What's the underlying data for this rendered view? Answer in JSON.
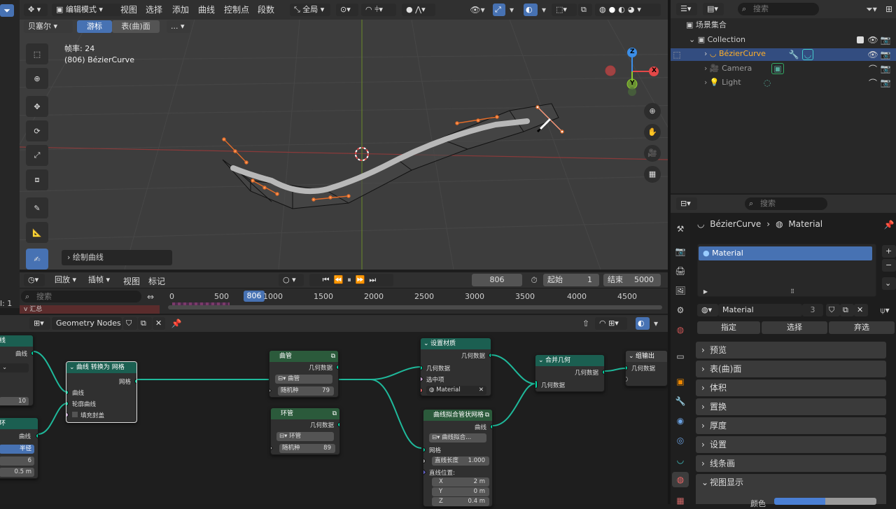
{
  "viewport": {
    "header": {
      "mode": "编辑模式",
      "menus": [
        "视图",
        "选择",
        "添加",
        "曲线",
        "控制点",
        "段数"
      ],
      "transform_orientation": "全局"
    },
    "subheader": {
      "curve_type": "贝塞尔",
      "tab_cursor": "游标",
      "tab_surface": "表(曲)面",
      "more": "..."
    },
    "overlay": {
      "fps": "帧率: 24",
      "object": "(806) BézierCurve"
    },
    "last_op": "绘制曲线",
    "gizmo": {
      "x": "X",
      "y": "Y",
      "z": "Z"
    }
  },
  "timeline": {
    "menus": [
      "回放",
      "插帧",
      "视图",
      "标记"
    ],
    "current_frame": "806",
    "start_label": "起始",
    "start_value": "1",
    "end_label": "结束",
    "end_value": "5000",
    "search_placeholder": "搜索",
    "ruler": [
      "0",
      "500",
      "806",
      "1000",
      "1500",
      "2000",
      "2500",
      "3000",
      "3500",
      "4000",
      "4500"
    ],
    "summary": "汇总",
    "left_label": "l: 1"
  },
  "node_editor": {
    "tree_name": "Geometry Nodes",
    "nodes": {
      "curve_in": {
        "out": "曲线",
        "value": "10"
      },
      "left_lower": {
        "title": "环",
        "out": "曲线",
        "radius": "半径",
        "count": "6",
        "size": "0.5 m"
      },
      "curve_to_mesh": {
        "title": "曲线 转换为 网格",
        "out": "网格",
        "in1": "曲线",
        "in2": "轮廓曲线",
        "in3": "填充封盖"
      },
      "tube": {
        "title": "曲管",
        "out": "几何数据",
        "select": "曲管",
        "seed_label": "随机种",
        "seed": "79"
      },
      "ring": {
        "title": "环管",
        "out": "几何数据",
        "select": "环管",
        "seed_label": "随机种",
        "seed": "89"
      },
      "set_material": {
        "title": "设置材质",
        "out": "几何数据",
        "in1": "几何数据",
        "in2": "选中项",
        "material": "Material"
      },
      "curve_pipe": {
        "title": "曲线拟合管状网格",
        "out": "曲线",
        "mode": "曲线拟合...",
        "in1": "网格",
        "len_label": "直线长度",
        "len": "1.000",
        "pos_label": "直线位置:",
        "x": "X",
        "xv": "2 m",
        "y": "Y",
        "yv": "0 m",
        "z": "Z",
        "zv": "0.4 m"
      },
      "join": {
        "title": "合并几何",
        "out": "几何数据",
        "in1": "几何数据"
      },
      "group_out": {
        "title": "组输出",
        "in1": "几何数据"
      }
    }
  },
  "outliner": {
    "search_placeholder": "搜索",
    "scene_collection": "场景集合",
    "collection": "Collection",
    "items": [
      "BézierCurve",
      "Camera",
      "Light"
    ]
  },
  "properties": {
    "search_placeholder": "搜索",
    "breadcrumb_object": "BézierCurve",
    "breadcrumb_material": "Material",
    "slot": "Material",
    "material_name": "Material",
    "users": "3",
    "assign": "指定",
    "select": "选择",
    "deselect": "弃选",
    "panels": [
      "预览",
      "表(曲)面",
      "体积",
      "置换",
      "厚度",
      "设置",
      "线条画",
      "视图显示"
    ],
    "color_label": "颜色"
  },
  "colors": {
    "accent": "#4772b3",
    "node_geo": "#1b5f51",
    "link": "#1fb99b",
    "x_axis": "#e44848",
    "y_axis": "#8bcb2e",
    "z_axis": "#3b8ee8"
  }
}
